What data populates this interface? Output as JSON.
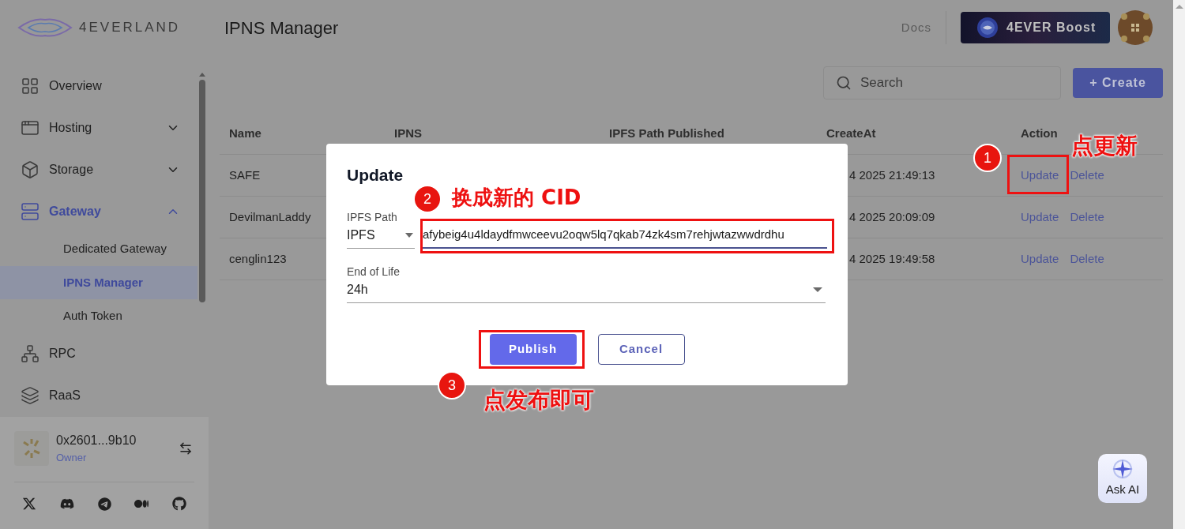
{
  "brand": {
    "logo_text": "4EVERLAND"
  },
  "header": {
    "title": "IPNS Manager",
    "docs_link": "Docs",
    "boost_button": "4EVER Boost"
  },
  "sidebar": {
    "items": [
      {
        "kind": "overview",
        "label": "Overview",
        "selected": false
      },
      {
        "kind": "hosting",
        "label": "Hosting",
        "expanded": false,
        "selected": false
      },
      {
        "kind": "storage",
        "label": "Storage",
        "expanded": false,
        "selected": false
      },
      {
        "kind": "gateway",
        "label": "Gateway",
        "expanded": true,
        "selected": true,
        "children": [
          {
            "label": "Dedicated Gateway",
            "selected": false
          },
          {
            "label": "IPNS Manager",
            "selected": true
          },
          {
            "label": "Auth Token",
            "selected": false
          }
        ]
      },
      {
        "kind": "rpc",
        "label": "RPC",
        "selected": false
      },
      {
        "kind": "raas",
        "label": "RaaS",
        "selected": false
      }
    ]
  },
  "account": {
    "address": "0x2601...9b10",
    "role": "Owner"
  },
  "toolbar": {
    "search": {
      "placeholder": "Search"
    },
    "create_button": "+ Create"
  },
  "table": {
    "columns": [
      "Name",
      "IPNS",
      "IPFS Path Published",
      "CreateAt",
      "Action"
    ],
    "rows": [
      {
        "name": "SAFE",
        "created_at": "4 2025 21:49:13",
        "actions": [
          "Update",
          "Delete"
        ]
      },
      {
        "name": "DevilmanLaddy",
        "created_at": "4 2025 20:09:09",
        "actions": [
          "Update",
          "Delete"
        ]
      },
      {
        "name": "cenglin123",
        "created_at": "4 2025 19:49:58",
        "actions": [
          "Update",
          "Delete"
        ]
      }
    ]
  },
  "dialog": {
    "title": "Update",
    "ipfs_path": {
      "label": "IPFS Path",
      "prefix": "IPFS",
      "value": "afybeig4u4ldaydfmwceevu2oqw5lq7qkab74zk4sm7rehjwtazwwdrdhu"
    },
    "end_of_life": {
      "label": "End of Life",
      "value": "24h"
    },
    "buttons": [
      {
        "kind": "primary",
        "label": "Publish"
      },
      {
        "kind": "secondary",
        "label": "Cancel"
      }
    ]
  },
  "annotations": [
    {
      "number": "1",
      "text": "点更新"
    },
    {
      "number": "2",
      "text": "换成新的 CID"
    },
    {
      "number": "3",
      "text": "点发布即可"
    }
  ],
  "ask_ai": {
    "label": "Ask AI"
  }
}
